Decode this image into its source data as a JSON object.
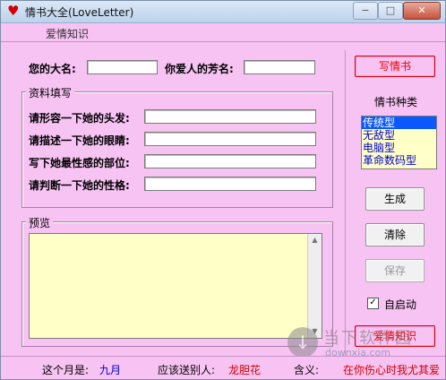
{
  "window": {
    "title": "情书大全(LoveLetter)",
    "minimize": "−",
    "maximize": "□",
    "close": "✕"
  },
  "menu": {
    "item": "爱情知识"
  },
  "form": {
    "your_name_label": "您的大名:",
    "your_name_value": "",
    "lover_name_label": "你爱人的芳名:",
    "lover_name_value": ""
  },
  "profile": {
    "title": "资料填写",
    "hair_label": "请形容一下她的头发:",
    "eyes_label": "请描述一下她的眼睛:",
    "sexiest_label": "写下她最性感的部位:",
    "personality_label": "请判断一下她的性格:"
  },
  "preview": {
    "title": "预览",
    "text": ""
  },
  "right": {
    "write_button": "写情书",
    "types_label": "情书种类",
    "types": [
      "传统型",
      "无敌型",
      "电脑型",
      "革命数码型"
    ],
    "selected_type": "传统型",
    "generate_button": "生成",
    "clear_button": "清除",
    "save_button": "保存",
    "autostart_label": "自启动",
    "autostart_checked": true,
    "knowledge_button": "爱情知识"
  },
  "status": {
    "month_label": "这个月是:",
    "month_value": "九月",
    "send_label": "应该送别人:",
    "send_value": "龙胆花",
    "meaning_label": "含义:",
    "meaning_value": "在你伤心时我尤其爱"
  },
  "watermark": {
    "text": "当下软件园",
    "sub": "downxia.com"
  },
  "colors": {
    "background": "#f7c3f3",
    "accent_red": "#e00000",
    "value_blue": "#0000cc",
    "textarea": "#ffffc8"
  }
}
